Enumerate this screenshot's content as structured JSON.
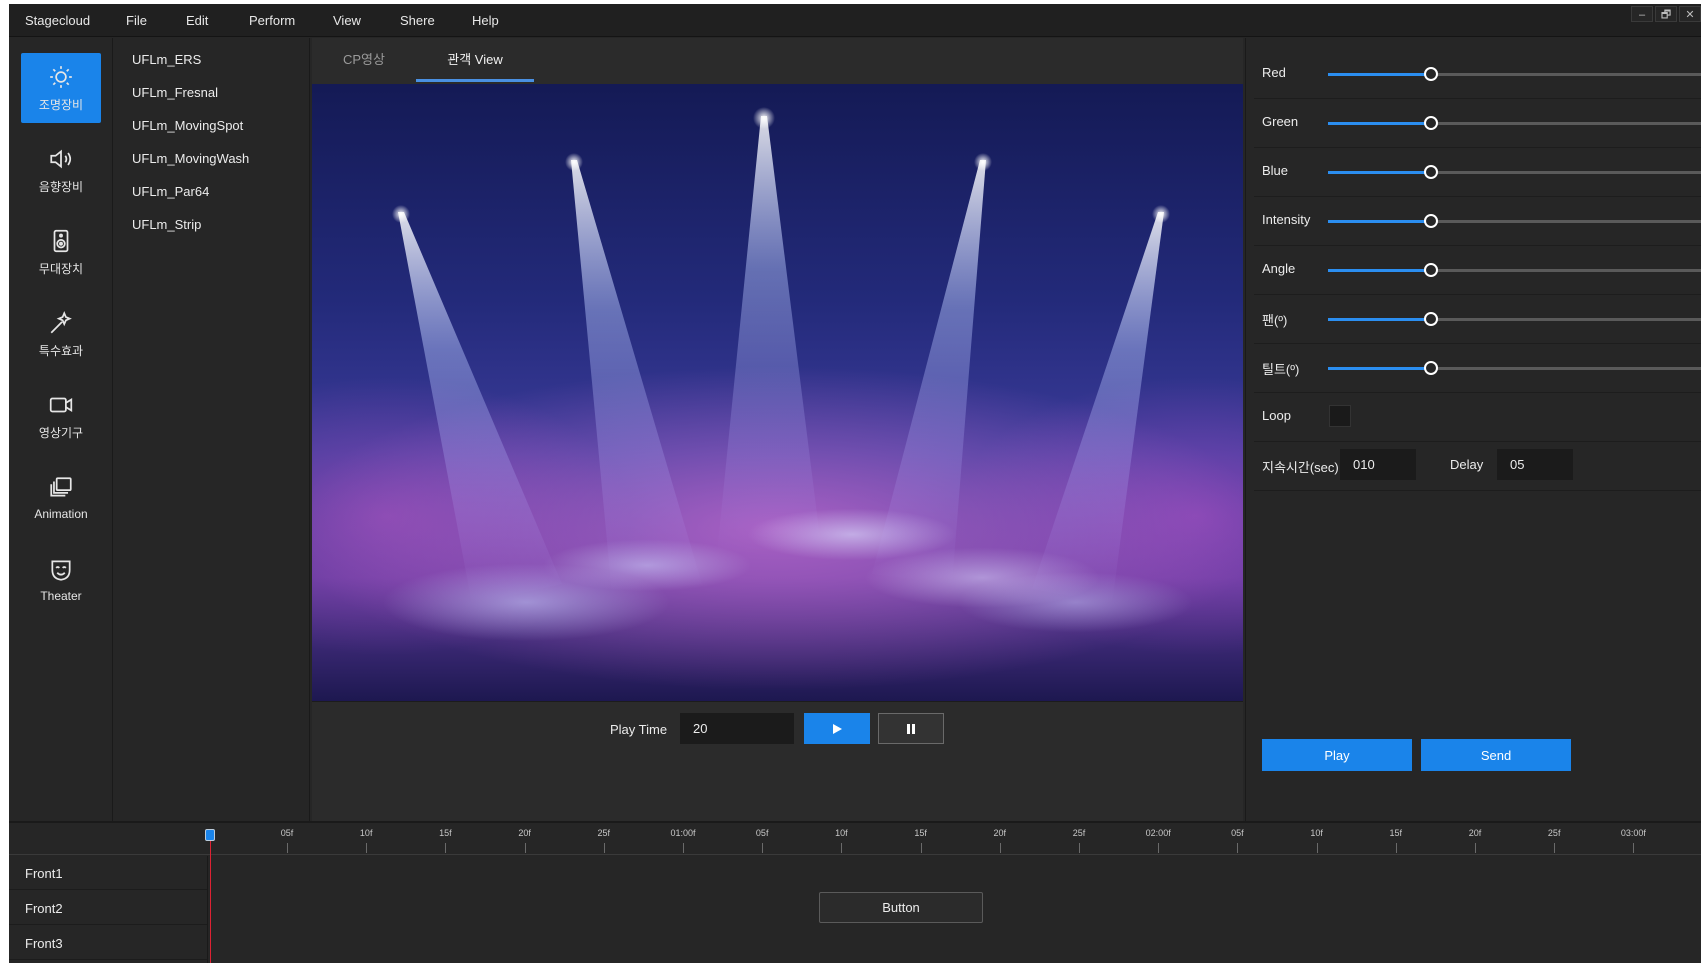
{
  "menubar": {
    "app_name": "Stagecloud",
    "items": [
      "File",
      "Edit",
      "Perform",
      "View",
      "Shere",
      "Help"
    ],
    "window_controls": [
      "–",
      "🗗",
      "✕"
    ]
  },
  "sidebar": {
    "items": [
      {
        "label": "조명장비",
        "icon": "sun-icon",
        "active": true
      },
      {
        "label": "음향장비",
        "icon": "speaker-icon",
        "active": false
      },
      {
        "label": "무대장치",
        "icon": "stage-speaker-icon",
        "active": false
      },
      {
        "label": "특수효과",
        "icon": "magic-wand-icon",
        "active": false
      },
      {
        "label": "영상기구",
        "icon": "video-camera-icon",
        "active": false
      },
      {
        "label": "Animation",
        "icon": "layers-icon",
        "active": false
      },
      {
        "label": "Theater",
        "icon": "mask-icon",
        "active": false
      }
    ]
  },
  "equipment": {
    "items": [
      "UFLm_ERS",
      "UFLm_Fresnal",
      "UFLm_MovingSpot",
      "UFLm_MovingWash",
      "UFLm_Par64",
      "UFLm_Strip"
    ]
  },
  "tabs": [
    {
      "label": "CP영상",
      "active": false
    },
    {
      "label": "관객 View",
      "active": true
    }
  ],
  "playbar": {
    "label": "Play Time",
    "value": "20",
    "play_icon": "play-icon",
    "pause_icon": "pause-icon"
  },
  "properties": {
    "sliders": [
      {
        "label": "Red",
        "value": 0.27
      },
      {
        "label": "Green",
        "value": 0.27
      },
      {
        "label": "Blue",
        "value": 0.27
      },
      {
        "label": "Intensity",
        "value": 0.27
      },
      {
        "label": "Angle",
        "value": 0.27
      },
      {
        "label": "팬(º)",
        "value": 0.27
      },
      {
        "label": "틸트(º)",
        "value": 0.27
      }
    ],
    "loop_label": "Loop",
    "duration_label": "지속시간(sec)",
    "duration_value": "010",
    "delay_label": "Delay",
    "delay_value": "05",
    "play_button": "Play",
    "send_button": "Send"
  },
  "timeline": {
    "ticks": [
      "05f",
      "10f",
      "15f",
      "20f",
      "25f",
      "01:00f",
      "05f",
      "10f",
      "15f",
      "20f",
      "25f",
      "02:00f",
      "05f",
      "10f",
      "15f",
      "20f",
      "25f",
      "03:00f"
    ],
    "tracks": [
      "Front1",
      "Front2",
      "Front3"
    ],
    "button_label": "Button"
  },
  "colors": {
    "accent": "#1a84ea",
    "background": "#262626"
  }
}
